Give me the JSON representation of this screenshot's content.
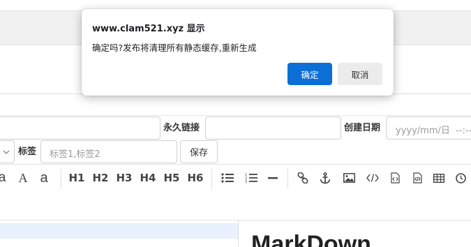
{
  "dialog": {
    "title": "www.clam521.xyz 显示",
    "message": "确定吗?发布将清理所有静态缓存,重新生成",
    "ok_label": "确定",
    "cancel_label": "取消"
  },
  "form": {
    "permalink_label": "永久链接",
    "created_label": "创建日期",
    "date_placeholder": "yyyy/mm/日  --:--",
    "tags_label": "标签",
    "tags_placeholder": "标签1,标签2",
    "save_label": "保存"
  },
  "toolbar": {
    "items": [
      "a",
      "A",
      "a",
      "H1",
      "H2",
      "H3",
      "H4",
      "H5",
      "H6"
    ],
    "icons": [
      "unordered-list-icon",
      "ordered-list-icon",
      "horizontal-rule-icon",
      "link-icon",
      "anchor-icon",
      "image-icon",
      "code-icon",
      "code-file-icon",
      "code-block-file-icon",
      "table-icon",
      "clock-icon"
    ]
  },
  "preview": {
    "heading": "MarkDown"
  }
}
